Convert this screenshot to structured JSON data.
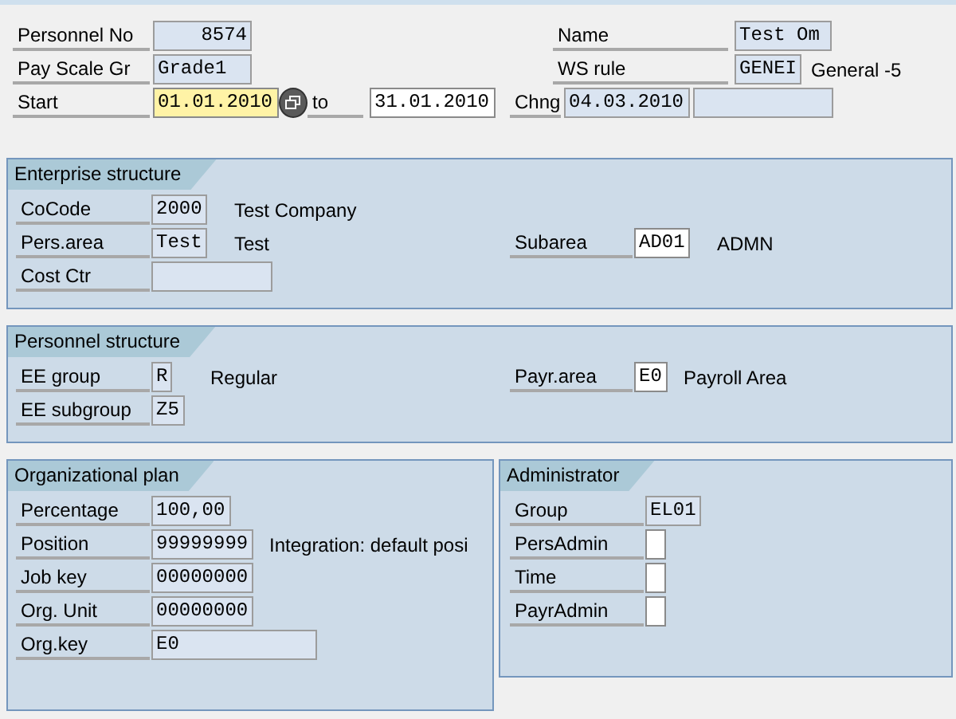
{
  "header": [
    {
      "left": [
        {
          "kind": "label",
          "text": "Personnel No"
        },
        {
          "kind": "field",
          "value": "8574",
          "editable": false,
          "focused": false
        }
      ],
      "right": [
        {
          "kind": "label",
          "text": "Name"
        },
        {
          "kind": "field",
          "value": "Test Om",
          "editable": false,
          "focused": false
        }
      ]
    },
    {
      "left": [
        {
          "kind": "label",
          "text": "Pay Scale Gr"
        },
        {
          "kind": "field",
          "value": "Grade1",
          "editable": false,
          "focused": false
        }
      ],
      "right": [
        {
          "kind": "label",
          "text": "WS rule"
        },
        {
          "kind": "field",
          "value": "GENEI",
          "editable": false,
          "focused": false
        },
        {
          "kind": "text",
          "text": "General -5"
        }
      ]
    },
    {
      "left": [
        {
          "kind": "label",
          "text": "Start"
        },
        {
          "kind": "field",
          "value": "01.01.2010",
          "editable": true,
          "focused": true
        },
        {
          "kind": "button"
        },
        {
          "kind": "label",
          "text": "to"
        },
        {
          "kind": "field",
          "value": "31.01.2010",
          "editable": true,
          "focused": false
        }
      ],
      "right": [
        {
          "kind": "label",
          "text": "Chng"
        },
        {
          "kind": "field",
          "value": "04.03.2010",
          "editable": false,
          "focused": false
        },
        {
          "kind": "field",
          "editable": false,
          "focused": false
        }
      ]
    }
  ],
  "group_rows": [
    {
      "groups": [
        {
          "title": "Enterprise structure",
          "rows": [
            {
              "left": [
                {
                  "kind": "label",
                  "text": "CoCode"
                },
                {
                  "kind": "field",
                  "value": "2000",
                  "editable": false,
                  "focused": false
                },
                {
                  "kind": "text",
                  "text": "Test Company"
                }
              ]
            },
            {
              "left": [
                {
                  "kind": "label",
                  "text": "Pers.area"
                },
                {
                  "kind": "field",
                  "value": "Test",
                  "editable": false,
                  "focused": false
                },
                {
                  "kind": "text",
                  "text": "Test"
                }
              ],
              "right": [
                {
                  "kind": "label",
                  "text": "Subarea"
                },
                {
                  "kind": "field",
                  "value": "AD01",
                  "editable": true,
                  "focused": false
                },
                {
                  "kind": "text",
                  "text": "ADMN"
                }
              ]
            },
            {
              "left": [
                {
                  "kind": "label",
                  "text": "Cost Ctr"
                },
                {
                  "kind": "field",
                  "editable": false,
                  "focused": false
                }
              ]
            }
          ]
        }
      ]
    },
    {
      "groups": [
        {
          "title": "Personnel structure",
          "rows": [
            {
              "left": [
                {
                  "kind": "label",
                  "text": "EE group"
                },
                {
                  "kind": "field",
                  "value": "R",
                  "editable": false,
                  "focused": false
                },
                {
                  "kind": "text",
                  "text": "Regular"
                }
              ],
              "right": [
                {
                  "kind": "label",
                  "text": "Payr.area"
                },
                {
                  "kind": "field",
                  "value": "E0",
                  "editable": true,
                  "focused": false
                },
                {
                  "kind": "text",
                  "text": "Payroll Area"
                }
              ]
            },
            {
              "left": [
                {
                  "kind": "label",
                  "text": "EE subgroup"
                },
                {
                  "kind": "field",
                  "value": "Z5",
                  "editable": false,
                  "focused": false
                }
              ]
            }
          ]
        }
      ]
    },
    {
      "groups": [
        {
          "title": "Organizational plan",
          "rows": [
            {
              "left": [
                {
                  "kind": "label",
                  "text": "Percentage"
                },
                {
                  "kind": "field",
                  "value": "100,00",
                  "editable": false,
                  "focused": false
                }
              ]
            },
            {
              "left": [
                {
                  "kind": "label",
                  "text": "Position"
                },
                {
                  "kind": "field",
                  "value": "99999999",
                  "editable": false,
                  "focused": false
                },
                {
                  "kind": "text",
                  "text": "Integration: default posi"
                }
              ]
            },
            {
              "left": [
                {
                  "kind": "label",
                  "text": "Job key"
                },
                {
                  "kind": "field",
                  "value": "00000000",
                  "editable": false,
                  "focused": false
                }
              ]
            },
            {
              "left": [
                {
                  "kind": "label",
                  "text": "Org. Unit"
                },
                {
                  "kind": "field",
                  "value": "00000000",
                  "editable": false,
                  "focused": false
                }
              ]
            },
            {
              "left": [
                {
                  "kind": "label",
                  "text": "Org.key"
                },
                {
                  "kind": "field",
                  "value": "E0",
                  "editable": false,
                  "focused": false
                }
              ]
            }
          ]
        },
        {
          "title": "Administrator",
          "rows": [
            {
              "left": [
                {
                  "kind": "label",
                  "text": "Group"
                },
                {
                  "kind": "field",
                  "value": "EL01",
                  "editable": false,
                  "focused": false
                }
              ]
            },
            {
              "left": [
                {
                  "kind": "label",
                  "text": "PersAdmin"
                },
                {
                  "kind": "field",
                  "editable": true,
                  "focused": false
                }
              ]
            },
            {
              "left": [
                {
                  "kind": "label",
                  "text": "Time"
                },
                {
                  "kind": "field",
                  "editable": true,
                  "focused": false
                }
              ]
            },
            {
              "left": [
                {
                  "kind": "label",
                  "text": "PayrAdmin"
                },
                {
                  "kind": "field",
                  "editable": true,
                  "focused": false
                }
              ]
            }
          ]
        }
      ]
    }
  ]
}
